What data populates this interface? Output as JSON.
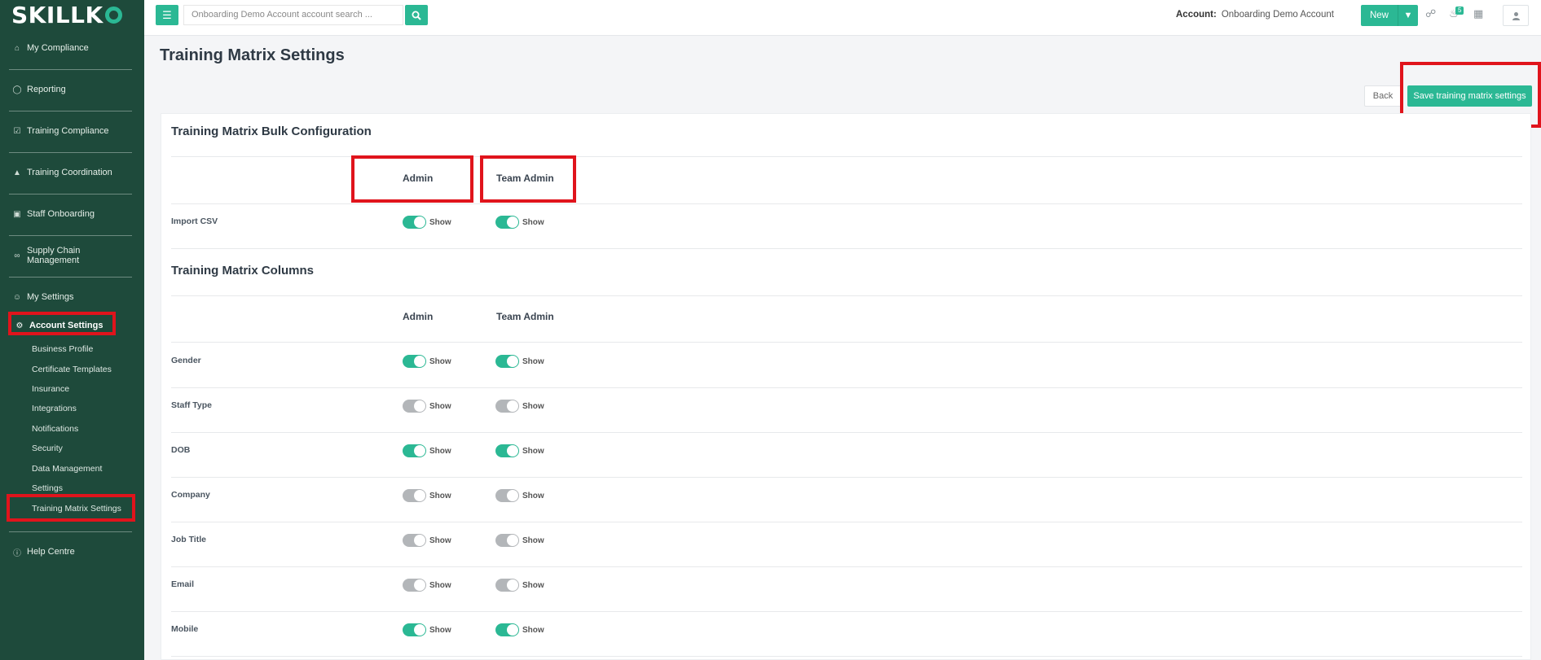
{
  "app": {
    "logo": "SKILLKO"
  },
  "sidebar": {
    "items": [
      {
        "label": "My Compliance",
        "icon": "home-icon"
      },
      {
        "label": "Reporting",
        "icon": "shield-icon"
      },
      {
        "label": "Training Compliance",
        "icon": "checkbox-icon"
      },
      {
        "label": "Training Coordination",
        "icon": "bank-icon"
      },
      {
        "label": "Staff Onboarding",
        "icon": "id-card-icon"
      },
      {
        "label": "Supply Chain Management",
        "icon": "link-icon"
      },
      {
        "label": "My Settings",
        "icon": "user-circle-icon"
      },
      {
        "label": "Account Settings",
        "icon": "gear-icon"
      }
    ],
    "sub_items": [
      "Business Profile",
      "Certificate Templates",
      "Insurance",
      "Integrations",
      "Notifications",
      "Security",
      "Data Management",
      "Settings",
      "Training Matrix Settings"
    ],
    "help": {
      "label": "Help Centre",
      "icon": "info-icon"
    }
  },
  "topbar": {
    "search_placeholder": "Onboarding Demo Account account search ...",
    "account_label": "Account:",
    "account_name": "Onboarding Demo Account",
    "new_label": "New",
    "notification_count": "5"
  },
  "page": {
    "title": "Training Matrix Settings",
    "back_label": "Back",
    "save_label": "Save training matrix settings"
  },
  "bulk": {
    "title": "Training Matrix Bulk Configuration",
    "columns": [
      "Admin",
      "Team Admin"
    ],
    "rows": [
      {
        "label": "Import CSV",
        "admin": true,
        "team_admin": true
      }
    ]
  },
  "columns_section": {
    "title": "Training Matrix Columns",
    "columns": [
      "Admin",
      "Team Admin"
    ],
    "rows": [
      {
        "label": "Gender",
        "admin": true,
        "team_admin": true
      },
      {
        "label": "Staff Type",
        "admin": false,
        "team_admin": false
      },
      {
        "label": "DOB",
        "admin": true,
        "team_admin": true
      },
      {
        "label": "Company",
        "admin": false,
        "team_admin": false
      },
      {
        "label": "Job Title",
        "admin": false,
        "team_admin": false
      },
      {
        "label": "Email",
        "admin": false,
        "team_admin": false
      },
      {
        "label": "Mobile",
        "admin": true,
        "team_admin": true
      }
    ]
  },
  "toggle_label": "Show",
  "colors": {
    "accent": "#2bb894",
    "sidebar": "#1e4a3b",
    "highlight": "#e0141c",
    "toggle_off": "#b3b6b9"
  }
}
